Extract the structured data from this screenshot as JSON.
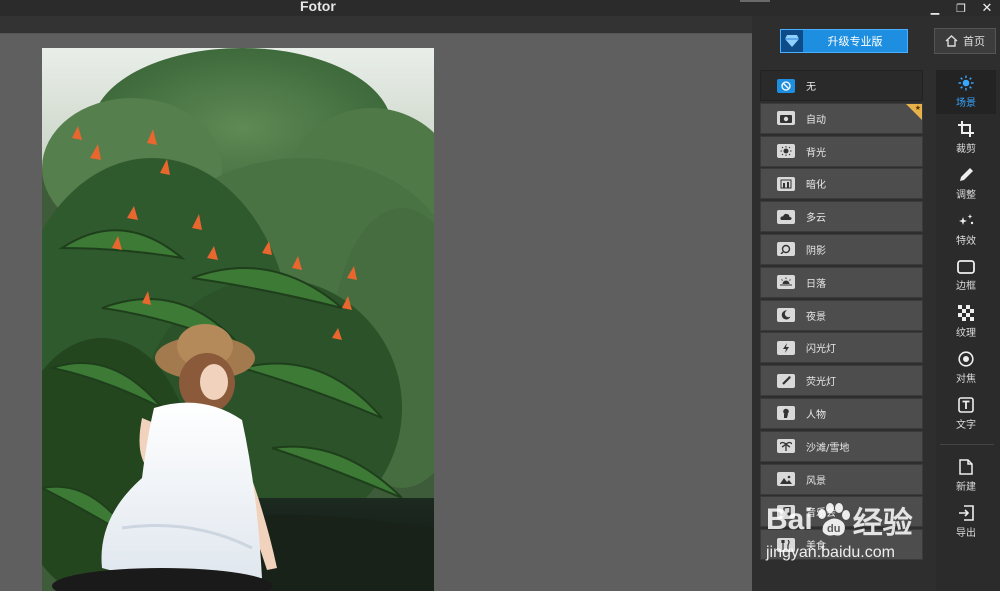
{
  "window": {
    "title": "Fotor",
    "minimize_glyph": "▁",
    "restore_glyph": "❐",
    "close_glyph": "✕"
  },
  "header": {
    "upgrade_label": "升级专业版",
    "home_label": "首页"
  },
  "scenes": [
    {
      "label": "无",
      "icon": "no-effect-icon",
      "selected": true
    },
    {
      "label": "自动",
      "icon": "camera-icon",
      "badge": true
    },
    {
      "label": "背光",
      "icon": "backlight-icon"
    },
    {
      "label": "暗化",
      "icon": "darken-icon"
    },
    {
      "label": "多云",
      "icon": "cloud-icon"
    },
    {
      "label": "阴影",
      "icon": "shadow-icon"
    },
    {
      "label": "日落",
      "icon": "sunset-icon"
    },
    {
      "label": "夜景",
      "icon": "moon-icon"
    },
    {
      "label": "闪光灯",
      "icon": "flash-icon"
    },
    {
      "label": "荧光灯",
      "icon": "fluorescent-icon"
    },
    {
      "label": "人物",
      "icon": "portrait-icon"
    },
    {
      "label": "沙滩/雪地",
      "icon": "beach-icon"
    },
    {
      "label": "风景",
      "icon": "landscape-icon"
    },
    {
      "label": "音乐会",
      "icon": "concert-icon"
    },
    {
      "label": "美食",
      "icon": "food-icon"
    }
  ],
  "tools": [
    {
      "label": "场景",
      "icon": "sun-icon",
      "selected": true
    },
    {
      "label": "裁剪",
      "icon": "crop-icon"
    },
    {
      "label": "调整",
      "icon": "pencil-icon"
    },
    {
      "label": "特效",
      "icon": "sparkle-icon"
    },
    {
      "label": "边框",
      "icon": "frame-icon"
    },
    {
      "label": "纹理",
      "icon": "texture-icon"
    },
    {
      "label": "对焦",
      "icon": "focus-icon"
    },
    {
      "label": "文字",
      "icon": "text-icon"
    }
  ],
  "file_tools": [
    {
      "label": "新建",
      "icon": "new-file-icon"
    },
    {
      "label": "导出",
      "icon": "export-icon"
    }
  ],
  "watermark": {
    "brand": "Bai",
    "brand_tail": "du",
    "brand_cn": "经验",
    "url": "jingyan.baidu.com"
  },
  "colors": {
    "accent": "#1e8fe0",
    "badge": "#e8b24a",
    "panel": "#2e2e2e",
    "canvas": "#5f5f5f"
  }
}
